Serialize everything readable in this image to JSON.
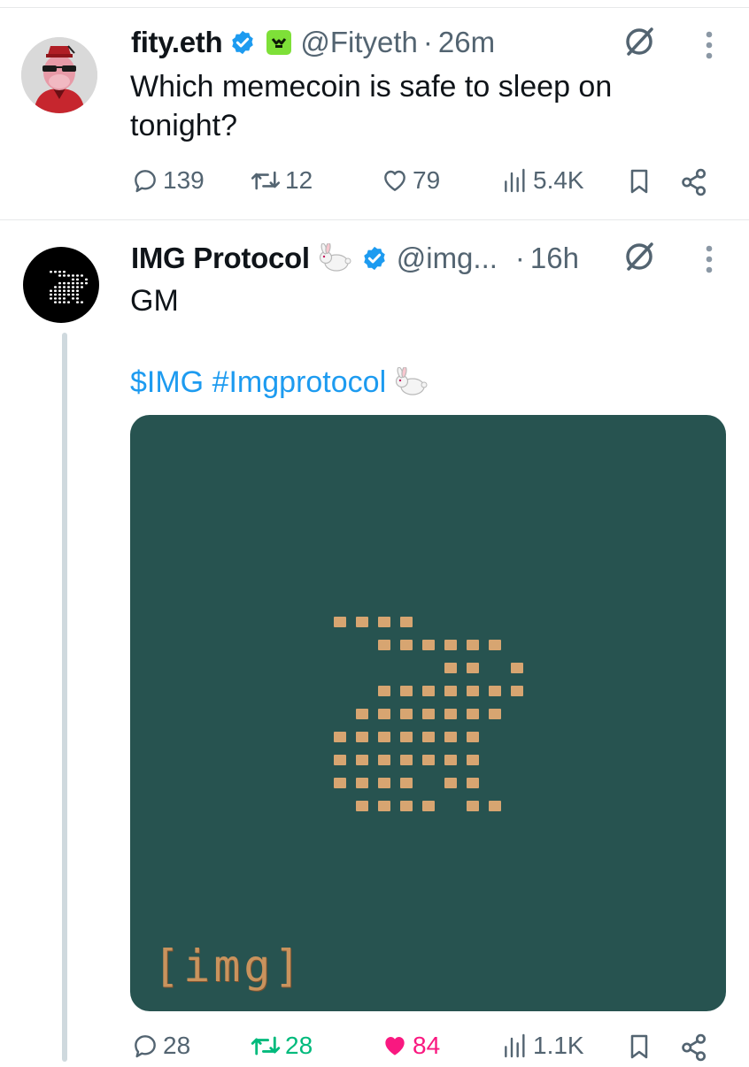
{
  "tweet1": {
    "name": "fity.eth",
    "handle": "@Fityeth",
    "separator": "·",
    "time": "26m",
    "text_line1": "Which memecoin is safe to sleep on",
    "text_line2": "tonight?",
    "replies": "139",
    "reposts": "12",
    "likes": "79",
    "views": "5.4K"
  },
  "tweet2": {
    "name": "IMG Protocol",
    "handle": "@img...",
    "separator": "·",
    "time": "16h",
    "text_line1": "GM",
    "text_line2": "$IMG #Imgprotocol",
    "media_caption": "[img]",
    "replies": "28",
    "reposts": "28",
    "likes": "84",
    "views": "1.1K"
  },
  "icons": {
    "verified": "verified-check-icon",
    "rabbit": "rabbit-emoji",
    "grok": "grok-icon",
    "more": "more-vertical-icon",
    "reply": "reply-icon",
    "repost": "repost-icon",
    "like": "heart-icon",
    "views": "views-icon",
    "bookmark": "bookmark-icon",
    "share": "share-icon"
  },
  "colors": {
    "accent": "#1d9bf0",
    "muted": "#536471",
    "repost_active": "#00ba7c",
    "like_active": "#f91880",
    "media_bg": "#275350"
  }
}
